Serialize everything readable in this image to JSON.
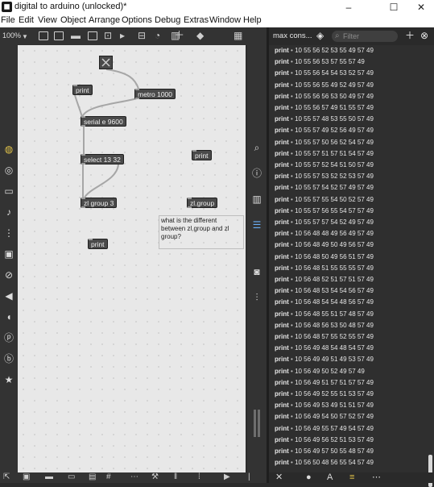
{
  "window": {
    "title": "digital to arduino (unlocked)*",
    "app_icon": "max-app-icon",
    "buttons": [
      "–",
      "☐",
      "✕"
    ]
  },
  "menu": [
    "File",
    "Edit",
    "View",
    "Object",
    "Arrange",
    "Options",
    "Debug",
    "Extras",
    "Window",
    "Help"
  ],
  "toolbar": {
    "zoom": "100%",
    "icons": [
      "object-box-icon",
      "message-box-icon",
      "comment-icon",
      "bang-icon",
      "toggle-icon",
      "number-icon",
      "slider-icon",
      "dial-icon",
      "keyboard-icon",
      "add-icon",
      "paint-icon",
      "grid-icon"
    ]
  },
  "left_sidebar": [
    "package-icon",
    "target-icon",
    "radio-icon",
    "music-icon",
    "route-icon",
    "image-icon",
    "link-icon",
    "plug-icon",
    "bell-icon",
    "p-icon",
    "b-icon",
    "star-icon"
  ],
  "right_sidebar": [
    "search-icon",
    "info-icon",
    "book-icon",
    "list-icon",
    "camera-icon",
    "mixer-icon"
  ],
  "patch": {
    "objects": {
      "print1": "print",
      "metro": "metro 1000",
      "serial": "serial e 9600",
      "select": "select 13 32",
      "zlgroup3": "zl group 3",
      "print2": "print",
      "zlgroup": "zl.group",
      "print3": "print"
    },
    "comment": "what is the different between zl.group and zl group?"
  },
  "console": {
    "title": "max cons...",
    "filter_placeholder": "Filter",
    "rows": [
      "10 55 56 52 53 55 49 57 49",
      "10 55 56 53 57 55 57 49",
      "10 55 56 54 54 53 52 57 49",
      "10 55 56 55 49 52 49 57 49",
      "10 55 56 56 53 50 49 57 49",
      "10 55 56 57 49 51 55 57 49",
      "10 55 57 48 53 55 50 57 49",
      "10 55 57 49 52 56 49 57 49",
      "10 55 57 50 56 52 54 57 49",
      "10 55 57 51 57 51 54 57 49",
      "10 55 57 52 54 51 50 57 49",
      "10 55 57 53 52 52 53 57 49",
      "10 55 57 54 52 57 49 57 49",
      "10 55 57 55 54 50 52 57 49",
      "10 55 57 56 55 54 57 57 49",
      "10 55 57 57 54 52 49 57 49",
      "10 56 48 48 49 56 49 57 49",
      "10 56 48 49 50 49 56 57 49",
      "10 56 48 50 49 56 51 57 49",
      "10 56 48 51 55 55 55 57 49",
      "10 56 48 52 51 57 51 57 49",
      "10 56 48 53 54 54 56 57 49",
      "10 56 48 54 54 48 56 57 49",
      "10 56 48 55 51 57 48 57 49",
      "10 56 48 56 53 50 48 57 49",
      "10 56 48 57 55 52 55 57 49",
      "10 56 49 48 54 48 54 57 49",
      "10 56 49 49 51 49 53 57 49",
      "10 56 49 50 52 49 57 49",
      "10 56 49 51 57 51 57 57 49",
      "10 56 49 52 55 51 53 57 49",
      "10 56 49 53 49 51 51 57 49",
      "10 56 49 54 50 57 52 57 49",
      "10 56 49 55 57 49 54 57 49",
      "10 56 49 56 52 51 53 57 49",
      "10 56 49 57 50 55 48 57 49",
      "10 56 50 48 56 55 54 57 49"
    ],
    "row_prefix": "print",
    "row_separator": "•",
    "bottom_icons": [
      "clear-icon",
      "pin-icon",
      "highlight-icon",
      "level-icon",
      "options-icon"
    ]
  }
}
